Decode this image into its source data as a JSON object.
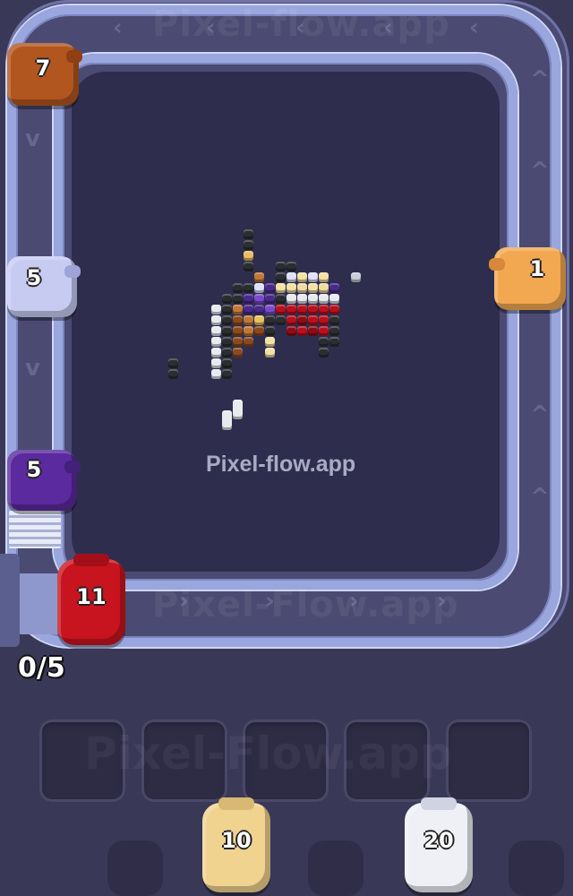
{
  "watermark": {
    "top": "Pixel-flow.app",
    "board": "Pixel-flow.app",
    "bottom_track": "Pixel-Flow.app",
    "slots": "Pixel-Flow.app"
  },
  "conveyor_shooters": [
    {
      "id": "shooter-orange",
      "ammo": "7",
      "color": "#b2561f"
    },
    {
      "id": "shooter-lavender",
      "ammo": "5",
      "color": "#c7cbf2"
    },
    {
      "id": "shooter-peach",
      "ammo": "1",
      "color": "#f2a850"
    },
    {
      "id": "shooter-purple",
      "ammo": "5",
      "color": "#5a2a9e"
    },
    {
      "id": "shooter-red",
      "ammo": "11",
      "color": "#c8141e"
    }
  ],
  "queue_shooters": [
    {
      "id": "queue-cream",
      "ammo": "10",
      "color": "#f1d390"
    },
    {
      "id": "queue-white",
      "ammo": "20",
      "color": "#eef0f6"
    }
  ],
  "conveyor_counter": "0/5",
  "slots": {
    "count": 5,
    "filled": 0
  },
  "colors": {
    "background": "#3a3857",
    "board": "#2f2d4d",
    "rail": "#9aa6de"
  }
}
